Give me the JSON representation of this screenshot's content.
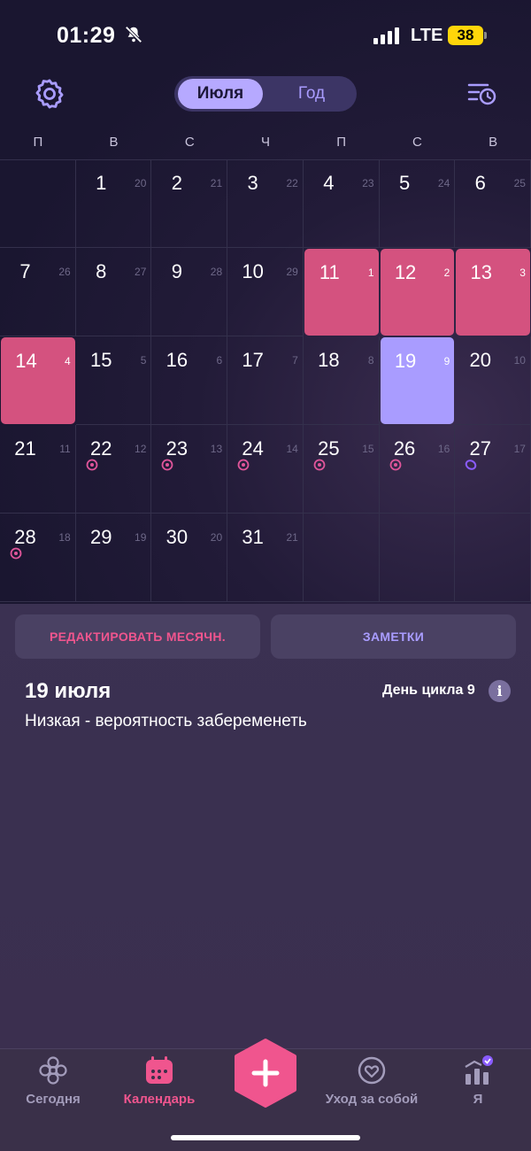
{
  "status": {
    "time": "01:29",
    "network": "LTE",
    "battery": "38"
  },
  "header": {
    "tab_month": "Июля",
    "tab_year": "Год"
  },
  "weekdays": [
    "П",
    "В",
    "С",
    "Ч",
    "П",
    "С",
    "В"
  ],
  "calendar": {
    "days": [
      {
        "day": "1",
        "cycle": "20"
      },
      {
        "day": "2",
        "cycle": "21"
      },
      {
        "day": "3",
        "cycle": "22"
      },
      {
        "day": "4",
        "cycle": "23"
      },
      {
        "day": "5",
        "cycle": "24"
      },
      {
        "day": "6",
        "cycle": "25"
      },
      {
        "day": "7",
        "cycle": "26"
      },
      {
        "day": "8",
        "cycle": "27"
      },
      {
        "day": "9",
        "cycle": "28"
      },
      {
        "day": "10",
        "cycle": "29"
      },
      {
        "day": "11",
        "cycle": "1"
      },
      {
        "day": "12",
        "cycle": "2"
      },
      {
        "day": "13",
        "cycle": "3"
      },
      {
        "day": "14",
        "cycle": "4"
      },
      {
        "day": "15",
        "cycle": "5"
      },
      {
        "day": "16",
        "cycle": "6"
      },
      {
        "day": "17",
        "cycle": "7"
      },
      {
        "day": "18",
        "cycle": "8"
      },
      {
        "day": "19",
        "cycle": "9"
      },
      {
        "day": "20",
        "cycle": "10"
      },
      {
        "day": "21",
        "cycle": "11"
      },
      {
        "day": "22",
        "cycle": "12"
      },
      {
        "day": "23",
        "cycle": "13"
      },
      {
        "day": "24",
        "cycle": "14"
      },
      {
        "day": "25",
        "cycle": "15"
      },
      {
        "day": "26",
        "cycle": "16"
      },
      {
        "day": "27",
        "cycle": "17"
      },
      {
        "day": "28",
        "cycle": "18"
      },
      {
        "day": "29",
        "cycle": "19"
      },
      {
        "day": "30",
        "cycle": "20"
      },
      {
        "day": "31",
        "cycle": "21"
      }
    ],
    "colors": {
      "period": "#d4527f",
      "today": "#a99cff",
      "fertile_marker": "#e0559a",
      "ovulation_marker": "#8a5cff"
    }
  },
  "actions": {
    "edit_period": "РЕДАКТИРОВАТЬ МЕСЯЧН.",
    "notes": "ЗАМЕТКИ"
  },
  "details": {
    "date": "19 июля",
    "cycle_day": "День цикла 9",
    "info_glyph": "i",
    "probability": "Низкая - вероятность забеременеть"
  },
  "nav": {
    "today": "Сегодня",
    "calendar": "Календарь",
    "selfcare": "Уход за собой",
    "me": "Я"
  }
}
